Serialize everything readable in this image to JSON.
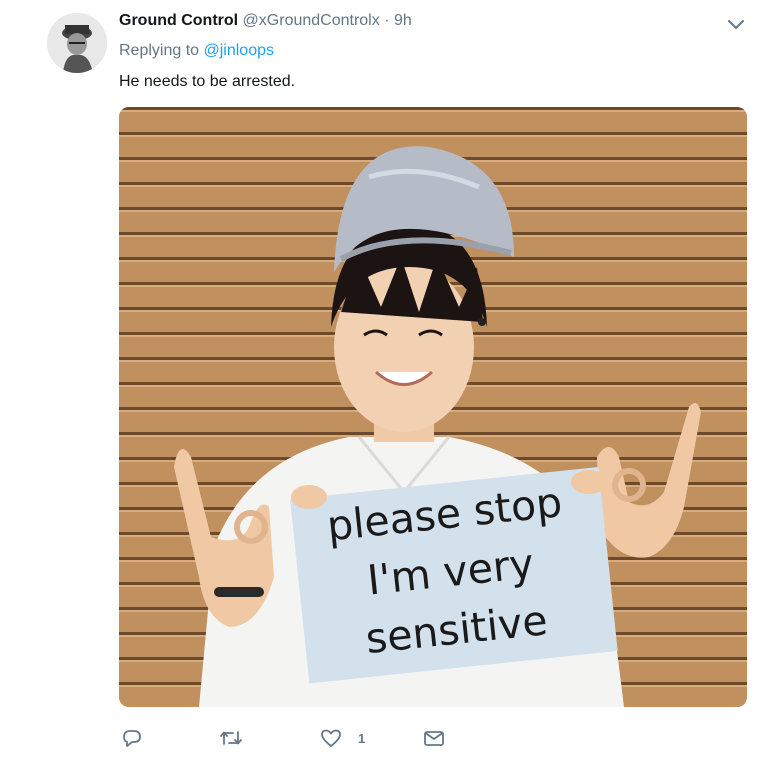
{
  "tweet": {
    "display_name": "Ground Control",
    "handle": "@xGroundControlx",
    "separator": "·",
    "time": "9h",
    "replying_prefix": "Replying to",
    "replying_to": "@jinloops",
    "text": "He needs to be arrested.",
    "media": {
      "sign_lines": [
        "please stop",
        "I'm very",
        "sensitive"
      ]
    },
    "actions": {
      "reply_count": "",
      "retweet_count": "",
      "like_count": "1",
      "icons": [
        "reply-icon",
        "retweet-icon",
        "like-icon",
        "direct-message-icon"
      ]
    }
  },
  "colors": {
    "link": "#1da1f2",
    "secondary_text": "#657786",
    "primary_text": "#14171a"
  }
}
